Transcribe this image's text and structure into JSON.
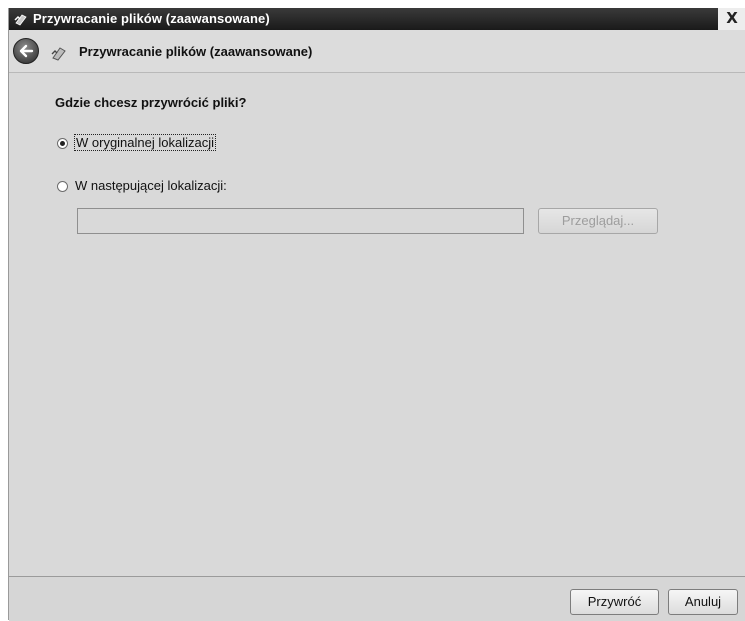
{
  "window": {
    "title": "Przywracanie plików (zaawansowane)",
    "close_glyph": "X"
  },
  "header": {
    "title": "Przywracanie plików (zaawansowane)",
    "back_icon": "back-arrow-icon",
    "wizard_icon": "restore-wizard-icon"
  },
  "main": {
    "question": "Gdzie chcesz przywrócić pliki?",
    "options": [
      {
        "label": "W oryginalnej lokalizacji",
        "selected": true
      },
      {
        "label": "W następującej lokalizacji:",
        "selected": false
      }
    ],
    "path_input": {
      "value": "",
      "placeholder": ""
    },
    "browse_label": "Przeglądaj..."
  },
  "footer": {
    "restore_label": "Przywróć",
    "cancel_label": "Anuluj"
  },
  "colors": {
    "background": "#d9d9d9",
    "titlebar": "#1a1a1a"
  }
}
